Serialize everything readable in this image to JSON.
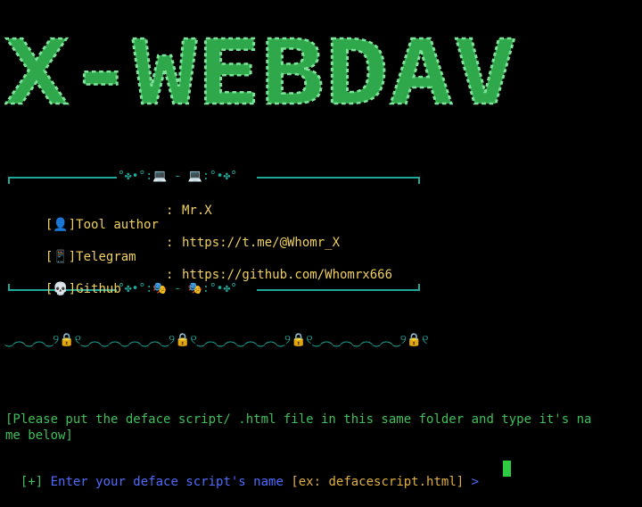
{
  "banner": {
    "text": "X-WEBDAV",
    "color": "#3fbf5a"
  },
  "frame": {
    "top_ornament": "°✤•°:💻 - 💻:°•✤°",
    "bottom_ornament": "°✤•°:🎭 - 🎭:°•✤°"
  },
  "info": [
    {
      "icon": "👤",
      "label": "Tool author",
      "sep": ":",
      "value": "Mr.X"
    },
    {
      "icon": "📱",
      "label": "Telegram",
      "sep": ":",
      "value": "https://t.me/@Whomr_X"
    },
    {
      "icon": "💀",
      "label": "Github",
      "sep": ":",
      "value": "https://github.com/Whomrx666"
    }
  ],
  "divider": "‿︵‿︵‿୨🔒୧‿︵‿︵‿︵‿︵‿୨🔒୧‿︵‿︵‿︵‿︵‿୨🔒୧‿︵‿︵‿︵‿︵‿୨🔒୧",
  "instruction_line1": "[Please put the deface script/ .html file in this same folder and type it's na",
  "instruction_line2": "me below]",
  "prompt": {
    "plus": "[+]",
    "text": " Enter your deface script's name ",
    "example": "[ex: defacescript.html]",
    "arrow": " > "
  },
  "colors": {
    "teal": "#1fa89a",
    "yellow": "#f0d060",
    "green": "#3fbf5a",
    "blue": "#4f6bff"
  }
}
